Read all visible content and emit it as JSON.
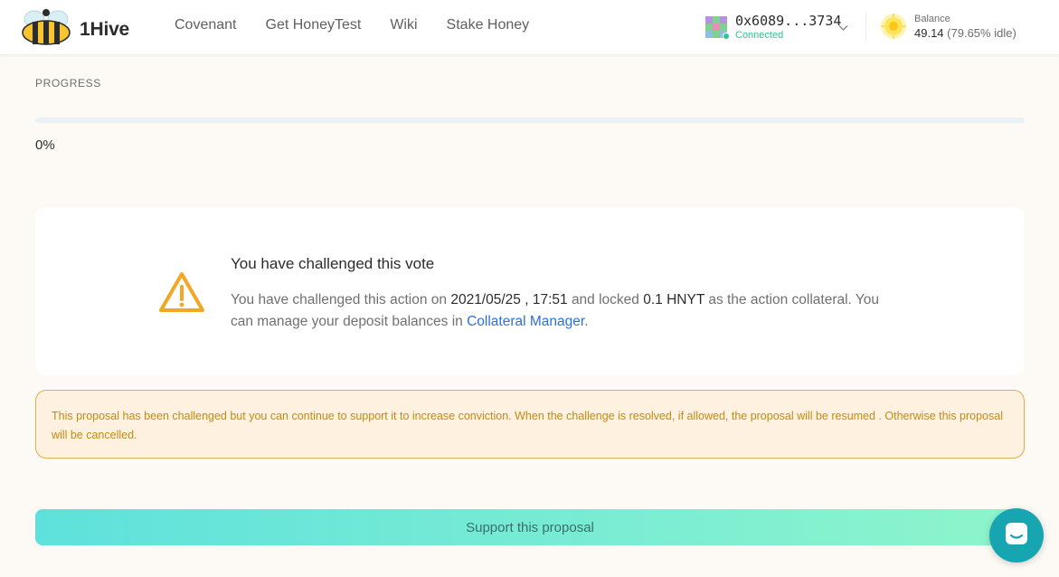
{
  "header": {
    "brand": "1Hive",
    "nav": [
      "Covenant",
      "Get HoneyTest",
      "Wiki",
      "Stake Honey"
    ],
    "account": {
      "address": "0x6089...3734",
      "status": "Connected"
    },
    "balance": {
      "label": "Balance",
      "value": "49.14",
      "idle": "(79.65% idle)"
    }
  },
  "progress": {
    "label": "PROGRESS",
    "percent_text": "0%",
    "fraction": 0
  },
  "challenge": {
    "title": "You have challenged this vote",
    "body_prefix": "You have challenged this action on",
    "date": "2021/05/25 , 17:51",
    "body_mid": "and locked",
    "amount": "0.1 HNYT",
    "body_suffix": "as the action collateral. You can manage your deposit balances in",
    "link": "Collateral Manager",
    "end": "."
  },
  "notice": "This proposal has been challenged but you can continue to support it to increase conviction. When the challenge is resolved, if allowed, the proposal will be resumed . Otherwise this proposal will be cancelled.",
  "support_button": "Support this proposal",
  "colors": {
    "accent": "#2a70e8",
    "connected": "#2cc68f",
    "warning": "#f5a623",
    "notice_text": "#c38b12",
    "chat": "#18a5b2"
  },
  "icons": [
    "bee-logo-icon",
    "identicon-icon",
    "chevron-down-icon",
    "honey-token-icon",
    "warning-icon",
    "chat-icon"
  ]
}
